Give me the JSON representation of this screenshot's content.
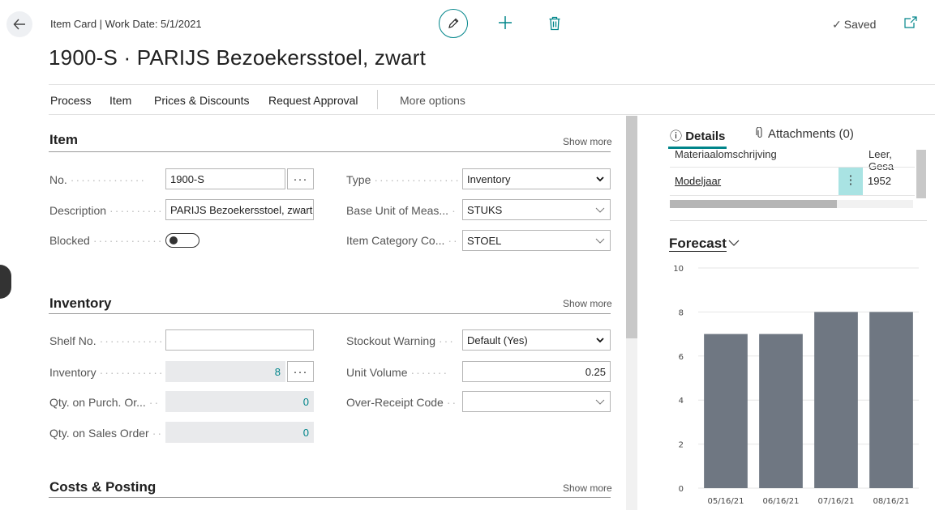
{
  "header": {
    "breadcrumb": "Item Card | Work Date: 5/1/2021",
    "title": "1900-S · PARIJS Bezoekersstoel, zwart",
    "saved_label": "Saved"
  },
  "actions": {
    "process": "Process",
    "item": "Item",
    "prices_discounts": "Prices & Discounts",
    "request_approval": "Request Approval",
    "more_options": "More options"
  },
  "sections": {
    "item": {
      "title": "Item",
      "show_more": "Show more",
      "no_label": "No.",
      "no_value": "1900-S",
      "description_label": "Description",
      "description_value": "PARIJS Bezoekersstoel, zwart",
      "blocked_label": "Blocked",
      "blocked_value": false,
      "type_label": "Type",
      "type_value": "Inventory",
      "base_unit_label": "Base Unit of Meas...",
      "base_unit_value": "STUKS",
      "item_category_label": "Item Category Co...",
      "item_category_value": "STOEL"
    },
    "inventory": {
      "title": "Inventory",
      "show_more": "Show more",
      "shelf_label": "Shelf No.",
      "shelf_value": "",
      "inventory_label": "Inventory",
      "inventory_value": "8",
      "qty_purch_label": "Qty. on Purch. Or...",
      "qty_purch_value": "0",
      "qty_sales_label": "Qty. on Sales Order",
      "qty_sales_value": "0",
      "stockout_label": "Stockout Warning",
      "stockout_value": "Default (Yes)",
      "unit_volume_label": "Unit Volume",
      "unit_volume_value": "0.25",
      "over_receipt_label": "Over-Receipt Code",
      "over_receipt_value": ""
    },
    "costs": {
      "title": "Costs & Posting",
      "show_more": "Show more"
    }
  },
  "factbox": {
    "tab_details": "Details",
    "tab_attachments": "Attachments (0)",
    "rows": [
      {
        "label": "Materiaalomschrijving",
        "value": "Leer, Gesa"
      },
      {
        "label": "Modeljaar",
        "value": "1952"
      }
    ],
    "forecast_title": "Forecast"
  },
  "colors": {
    "accent": "#00858a",
    "bar": "#6f7782"
  },
  "chart_data": {
    "type": "bar",
    "categories": [
      "05/16/21",
      "06/16/21",
      "07/16/21",
      "08/16/21"
    ],
    "values": [
      7,
      7,
      8,
      8
    ],
    "ylim": [
      0,
      10
    ],
    "yticks": [
      0,
      2,
      4,
      6,
      8,
      10
    ],
    "grid": true
  }
}
